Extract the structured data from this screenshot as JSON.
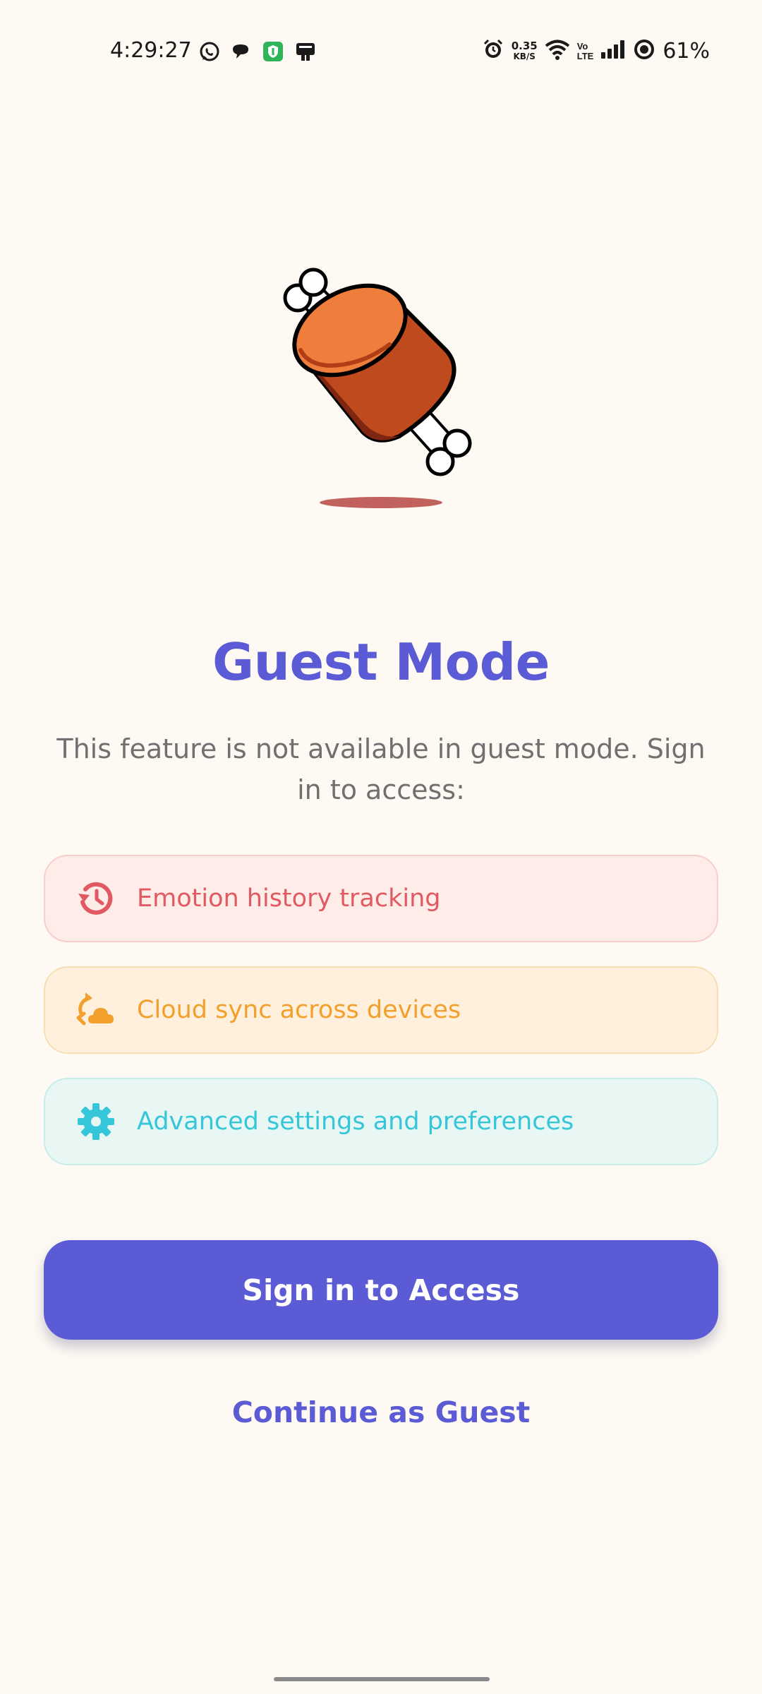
{
  "status_bar": {
    "time": "4:29:27",
    "net_speed_value": "0.35",
    "net_speed_unit": "KB/S",
    "volte_top": "Vo",
    "volte_bottom": "LTE",
    "battery": "61%",
    "icons": [
      "whatsapp-icon",
      "chat-bubble-icon",
      "shield-app-icon",
      "notification-app-icon",
      "alarm-icon",
      "wifi-icon",
      "signal-icon",
      "battery-ring-icon"
    ]
  },
  "illustration": {
    "name": "meat-on-bone",
    "colors": {
      "meat_top": "#EF7D3B",
      "meat_side": "#BE4A1E",
      "meat_dark": "#7E2612",
      "shadow": "#C2625E"
    }
  },
  "main": {
    "title": "Guest Mode",
    "subtitle": "This feature is not available in guest mode. Sign in to access:"
  },
  "features": [
    {
      "icon": "history-icon",
      "label": "Emotion history tracking",
      "color": "#E15A63"
    },
    {
      "icon": "cloud-sync-icon",
      "label": "Cloud sync across devices",
      "color": "#F2A02B"
    },
    {
      "icon": "gear-icon",
      "label": "Advanced settings and preferences",
      "color": "#36C6DA"
    }
  ],
  "actions": {
    "primary_label": "Sign in to Access",
    "secondary_label": "Continue as Guest",
    "accent": "#5B5BD6"
  },
  "background": "#FEFAF3"
}
